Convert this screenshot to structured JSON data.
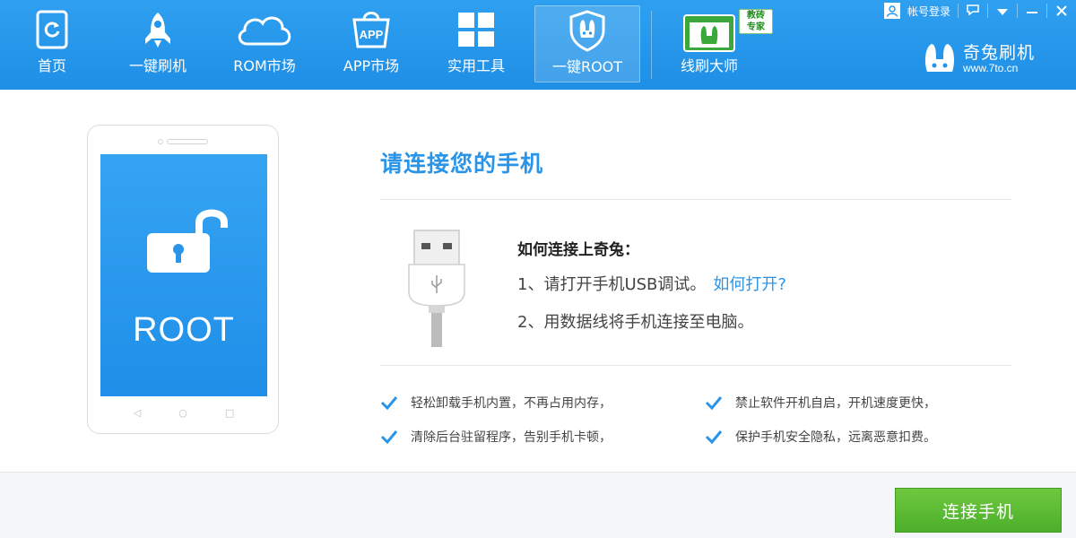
{
  "app": {
    "brand_name": "奇兔刷机",
    "brand_url": "www.7to.cn"
  },
  "topbar": {
    "account_label": "帐号登录"
  },
  "nav": {
    "items": [
      {
        "label": "首页",
        "icon": "home-icon"
      },
      {
        "label": "一键刷机",
        "icon": "rocket-icon"
      },
      {
        "label": "ROM市场",
        "icon": "cloud-icon"
      },
      {
        "label": "APP市场",
        "icon": "app-bag-icon",
        "icon_text": "APP"
      },
      {
        "label": "实用工具",
        "icon": "windows-grid-icon"
      },
      {
        "label": "一键ROOT",
        "icon": "shield-rabbit-icon",
        "active": true
      },
      {
        "label": "线刷大师",
        "icon": "line-flash-icon",
        "badge": [
          "教砖",
          "专家"
        ]
      }
    ]
  },
  "main": {
    "phone_screen_text": "ROOT",
    "title": "请连接您的手机",
    "how_title": "如何连接上奇兔：",
    "step1_text": "1、请打开手机USB调试。",
    "step1_link": "如何打开?",
    "step2_text": "2、用数据线将手机连接至电脑。",
    "features": [
      "轻松卸载手机内置，不再占用内存，",
      "禁止软件开机自启，开机速度更快，",
      "清除后台驻留程序，告别手机卡顿，",
      "保护手机安全隐私，远离恶意扣费。"
    ]
  },
  "footer": {
    "connect_button": "连接手机"
  },
  "colors": {
    "header_blue": "#2196ee",
    "accent_blue": "#2a95e8",
    "button_green": "#58b830",
    "check_blue": "#2a95e8"
  }
}
